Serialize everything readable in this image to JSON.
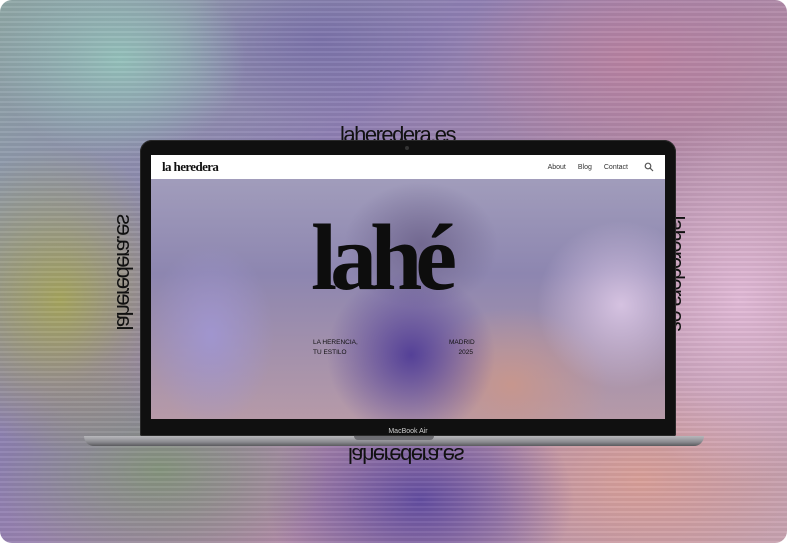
{
  "surround": {
    "domain_text": "laheredera.es"
  },
  "site": {
    "logo": "la heredera",
    "nav": {
      "about": "About",
      "blog": "Blog",
      "contact": "Contact"
    },
    "hero": {
      "title": "lahé",
      "left_line1": "LA HERENCIA,",
      "left_line2": "TU ESTILO",
      "right_line1": "MADRID",
      "right_line2": "2025"
    }
  },
  "device": {
    "label": "MacBook Air"
  },
  "icons": {
    "search": "search-icon"
  }
}
